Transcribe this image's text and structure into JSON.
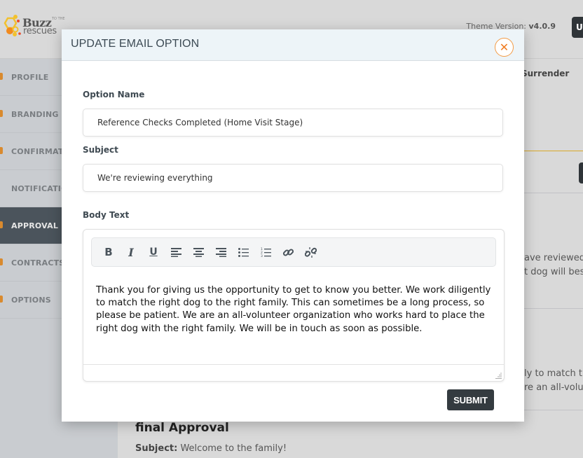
{
  "header": {
    "logo": {
      "name": "Buzz",
      "small": "TO THE",
      "sub": "rescues"
    },
    "theme_version_label": "Theme Version:",
    "theme_version_value": "v4.0.9",
    "user_button_label": "U"
  },
  "sidebar": {
    "items": [
      {
        "label": "PROFILE",
        "active": false
      },
      {
        "label": "BRANDING",
        "active": false
      },
      {
        "label": "CONFIRMATIONS",
        "active": false
      },
      {
        "label": "NOTIFICATIONS",
        "active": false
      },
      {
        "label": "APPROVAL PROCESS",
        "active": true
      },
      {
        "label": "CONTRACTS",
        "active": false
      },
      {
        "label": "OPTIONS",
        "active": false
      }
    ]
  },
  "background": {
    "tab_label": "Surrender",
    "snippet_1_line_1": "ave reviewed",
    "snippet_1_line_2": "t dog will bes",
    "snippet_2_line_1": "ly to match t",
    "snippet_2_line_2": "re an all-volu",
    "final_title": "final Approval",
    "final_subject_label": "Subject:",
    "final_subject_value": "Welcome to the family!"
  },
  "modal": {
    "title": "UPDATE EMAIL OPTION",
    "close_icon": "close-x",
    "option_name_label": "Option Name",
    "option_name_value": "Reference Checks Completed (Home Visit Stage)",
    "subject_label": "Subject",
    "subject_value": "We're reviewing everything",
    "body_label": "Body Text",
    "toolbar": [
      {
        "name": "bold",
        "glyph": "B"
      },
      {
        "name": "italic",
        "glyph": "I"
      },
      {
        "name": "underline",
        "glyph": "U"
      },
      {
        "name": "align-left"
      },
      {
        "name": "align-center"
      },
      {
        "name": "align-right"
      },
      {
        "name": "bullet-list"
      },
      {
        "name": "numbered-list"
      },
      {
        "name": "link"
      },
      {
        "name": "unlink"
      }
    ],
    "body_text": "Thank you for giving us the opportunity to get to know you better. We work diligently to match the right dog to the right family. This can sometimes be a long process, so please be patient. We are an all-volunteer organization who works hard to place the right dog with the right family. We will be in touch as soon as possible.",
    "submit_label": "SUBMIT"
  },
  "colors": {
    "accent_orange": "#f07d22",
    "active_sidebar": "#4b545c",
    "dark_button": "#343b40",
    "header_bg": "#edf4f8"
  }
}
